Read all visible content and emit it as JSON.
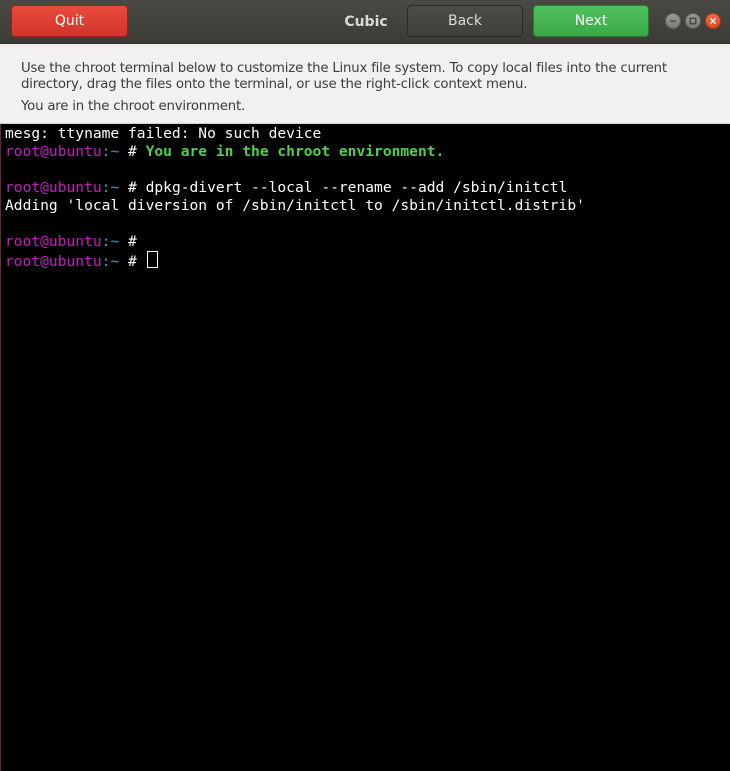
{
  "header": {
    "title": "Cubic",
    "quit_label": "Quit",
    "back_label": "Back",
    "next_label": "Next",
    "window_controls": {
      "minimize_icon": "minimize-icon",
      "maximize_icon": "maximize-icon",
      "close_icon": "close-icon"
    }
  },
  "info": {
    "description": "Use the chroot terminal below to customize the Linux file system. To copy local files into the current directory, drag the files onto the terminal, or use the right-click context menu.",
    "status": "You are in the chroot environment."
  },
  "terminal": {
    "lines": [
      {
        "type": "output",
        "text": "mesg: ttyname failed: No such device"
      },
      {
        "type": "prompt",
        "user": "root@ubuntu",
        "path": ":~",
        "symbol": " # ",
        "command": "You are in the chroot environment.",
        "style": "green-bold"
      },
      {
        "type": "blank"
      },
      {
        "type": "prompt",
        "user": "root@ubuntu",
        "path": ":~",
        "symbol": " # ",
        "command": "dpkg-divert --local --rename --add /sbin/initctl",
        "style": "plain"
      },
      {
        "type": "output",
        "text": "Adding 'local diversion of /sbin/initctl to /sbin/initctl.distrib'"
      },
      {
        "type": "blank"
      },
      {
        "type": "prompt",
        "user": "root@ubuntu",
        "path": ":~",
        "symbol": " #",
        "command": "",
        "style": "plain"
      },
      {
        "type": "prompt",
        "user": "root@ubuntu",
        "path": ":~",
        "symbol": " # ",
        "command": "",
        "style": "plain",
        "cursor": true
      }
    ]
  },
  "colors": {
    "quit": "#e0443a",
    "next": "#44b553",
    "prompt_user": "#c71cc2",
    "prompt_path": "#34a0b8",
    "highlight": "#4fd14f"
  }
}
